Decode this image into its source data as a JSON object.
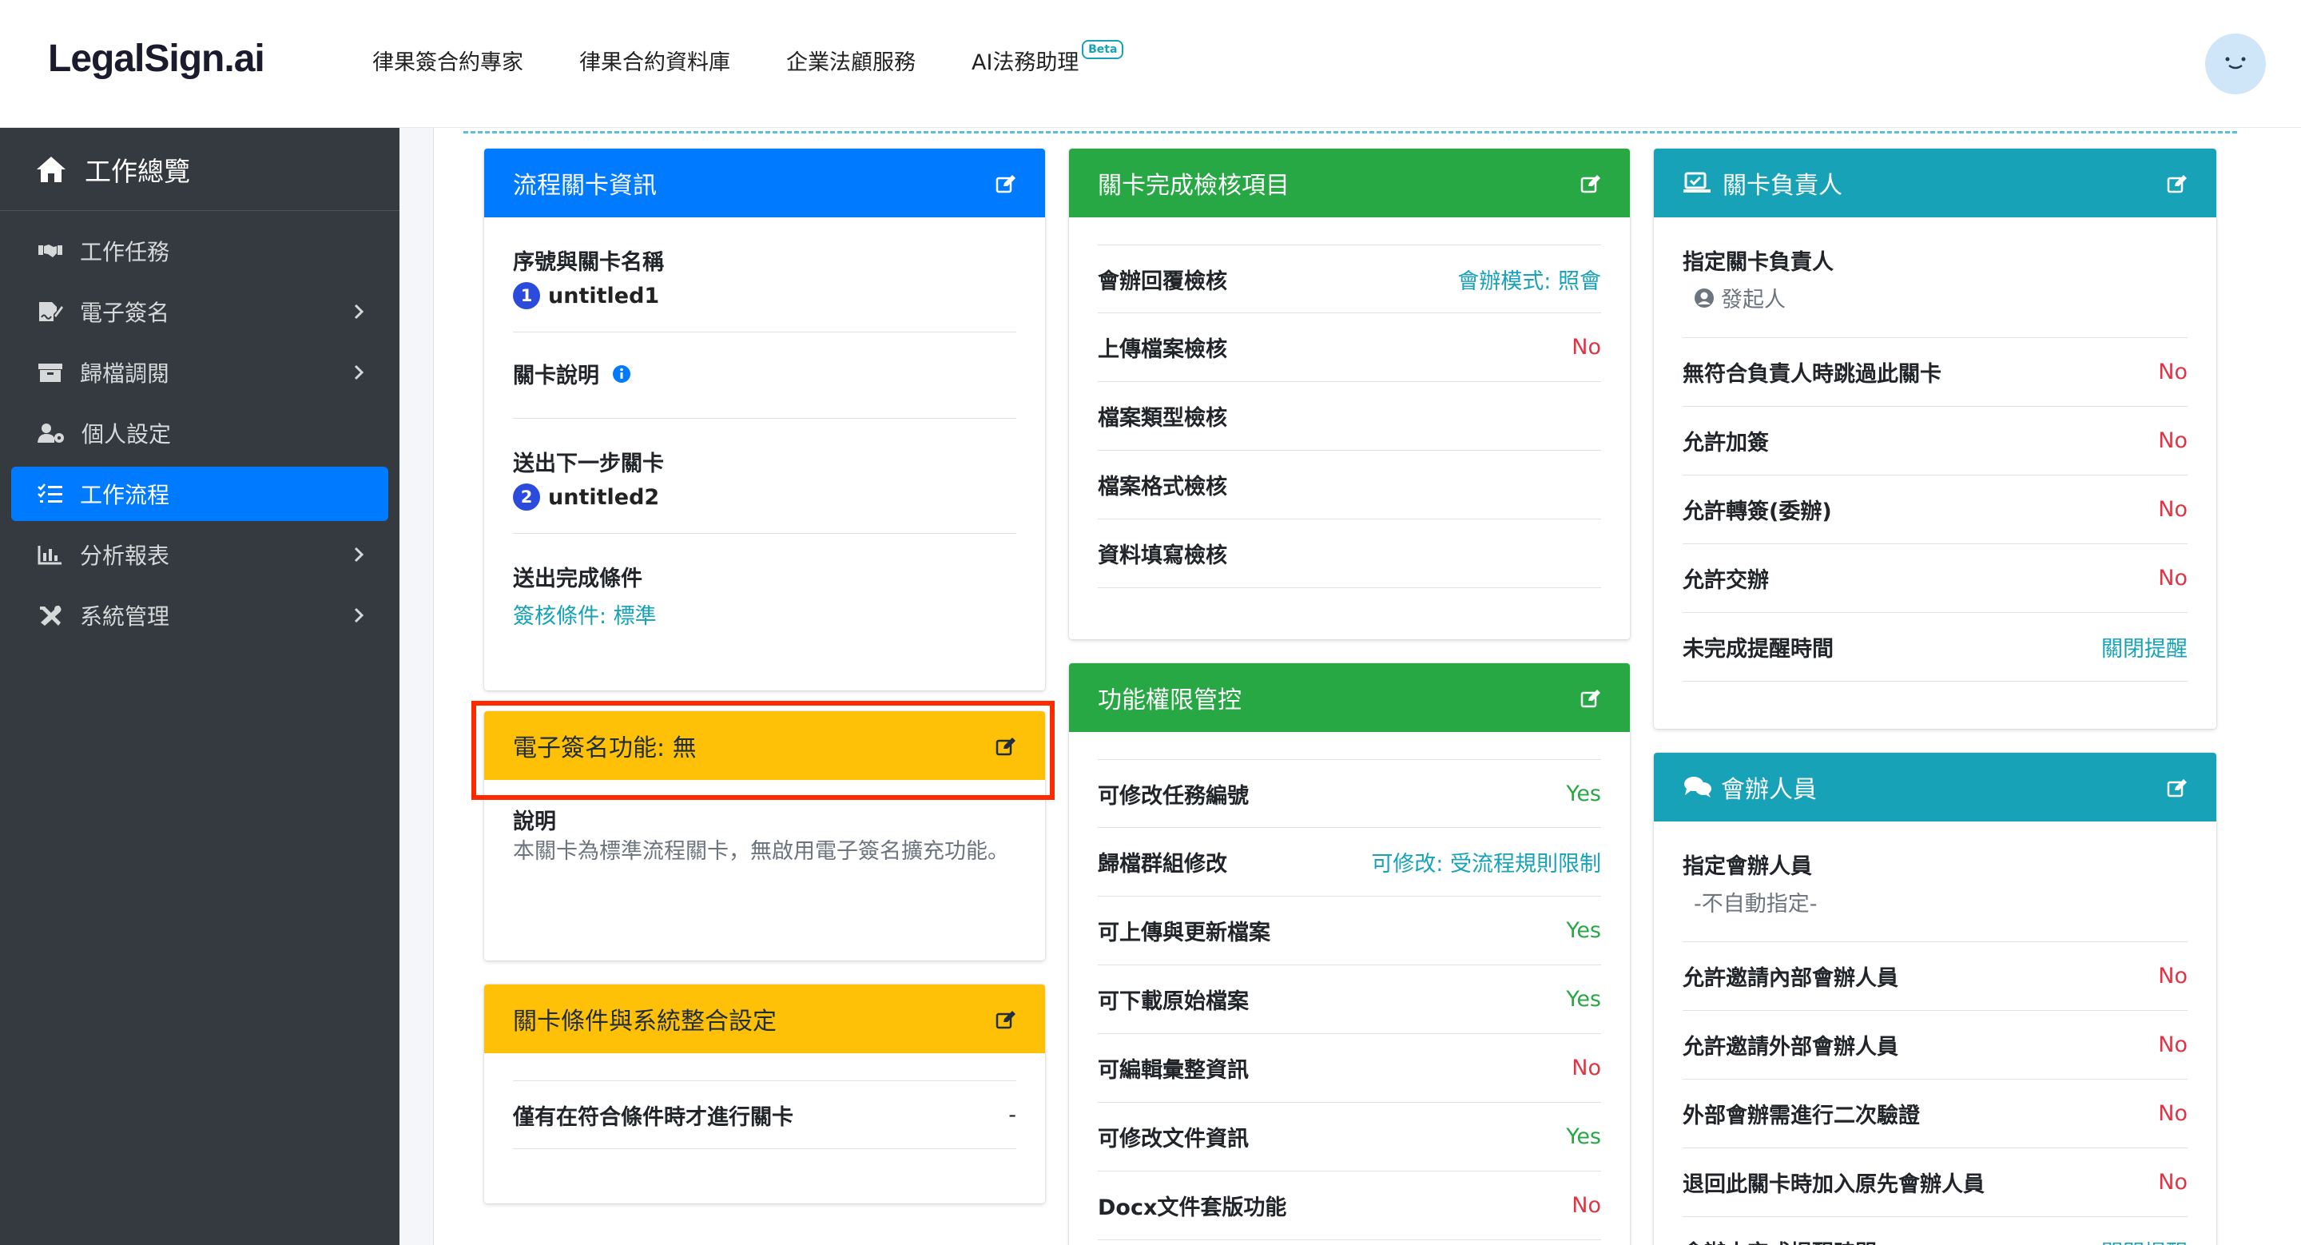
{
  "header": {
    "logo": "LegalSign.ai",
    "nav": [
      "律果簽合約專家",
      "律果合約資料庫",
      "企業法顧服務",
      "AI法務助理"
    ],
    "beta": "Beta"
  },
  "sidebar": {
    "title": "工作總覽",
    "items": [
      {
        "label": "工作任務",
        "icon": "handshake-icon",
        "chevron": false,
        "active": false
      },
      {
        "label": "電子簽名",
        "icon": "signature-icon",
        "chevron": true,
        "active": false
      },
      {
        "label": "歸檔調閱",
        "icon": "archive-icon",
        "chevron": true,
        "active": false
      },
      {
        "label": "個人設定",
        "icon": "user-cog-icon",
        "chevron": false,
        "active": false
      },
      {
        "label": "工作流程",
        "icon": "tasks-icon",
        "chevron": false,
        "active": true
      },
      {
        "label": "分析報表",
        "icon": "chart-icon",
        "chevron": true,
        "active": false
      },
      {
        "label": "系統管理",
        "icon": "tools-icon",
        "chevron": true,
        "active": false
      }
    ]
  },
  "flow_info": {
    "title": "流程關卡資訊",
    "seq_label": "序號與關卡名稱",
    "seq_num": "1",
    "seq_name": "untitled1",
    "desc_label": "關卡說明",
    "next_label": "送出下一步關卡",
    "next_num": "2",
    "next_name": "untitled2",
    "cond_label": "送出完成條件",
    "cond_value": "簽核條件: 標準"
  },
  "esign": {
    "title": "電子簽名功能: 無",
    "desc_label": "說明",
    "desc_text": "本關卡為標準流程關卡，無啟用電子簽名擴充功能。"
  },
  "integration": {
    "title": "關卡條件與系統整合設定",
    "rows": [
      {
        "label": "僅有在符合條件時才進行關卡",
        "value": "-"
      }
    ]
  },
  "checks": {
    "title": "關卡完成檢核項目",
    "rows": [
      {
        "label": "會辦回覆檢核",
        "value": "會辦模式: 照會",
        "type": "link"
      },
      {
        "label": "上傳檔案檢核",
        "value": "No",
        "type": "no"
      },
      {
        "label": "檔案類型檢核",
        "value": "",
        "type": "none"
      },
      {
        "label": "檔案格式檢核",
        "value": "",
        "type": "none"
      },
      {
        "label": "資料填寫檢核",
        "value": "",
        "type": "none"
      }
    ]
  },
  "permissions": {
    "title": "功能權限管控",
    "rows": [
      {
        "label": "可修改任務編號",
        "value": "Yes",
        "type": "yes"
      },
      {
        "label": "歸檔群組修改",
        "value": "可修改: 受流程規則限制",
        "type": "link"
      },
      {
        "label": "可上傳與更新檔案",
        "value": "Yes",
        "type": "yes"
      },
      {
        "label": "可下載原始檔案",
        "value": "Yes",
        "type": "yes"
      },
      {
        "label": "可編輯彙整資訊",
        "value": "No",
        "type": "no"
      },
      {
        "label": "可修改文件資訊",
        "value": "Yes",
        "type": "yes"
      },
      {
        "label": "Docx文件套版功能",
        "value": "No",
        "type": "no"
      }
    ]
  },
  "owner": {
    "title": "關卡負責人",
    "assign_label": "指定關卡負責人",
    "assign_value": "發起人",
    "rows": [
      {
        "label": "無符合負責人時跳過此關卡",
        "value": "No",
        "type": "no"
      },
      {
        "label": "允許加簽",
        "value": "No",
        "type": "no"
      },
      {
        "label": "允許轉簽(委辦)",
        "value": "No",
        "type": "no"
      },
      {
        "label": "允許交辦",
        "value": "No",
        "type": "no"
      },
      {
        "label": "未完成提醒時間",
        "value": "關閉提醒",
        "type": "link"
      }
    ]
  },
  "cosign": {
    "title": "會辦人員",
    "assign_label": "指定會辦人員",
    "assign_value": "-不自動指定-",
    "rows": [
      {
        "label": "允許邀請內部會辦人員",
        "value": "No",
        "type": "no"
      },
      {
        "label": "允許邀請外部會辦人員",
        "value": "No",
        "type": "no"
      },
      {
        "label": "外部會辦需進行二次驗證",
        "value": "No",
        "type": "no"
      },
      {
        "label": "退回此關卡時加入原先會辦人員",
        "value": "No",
        "type": "no"
      },
      {
        "label": "會辦未完成提醒時間",
        "value": "關閉提醒",
        "type": "link"
      }
    ]
  },
  "colors": {
    "blue": "#007bff",
    "green": "#28a745",
    "teal": "#17a2b8",
    "yellow": "#ffc107",
    "sidebar": "#343a40",
    "highlight": "#ff2a00"
  }
}
